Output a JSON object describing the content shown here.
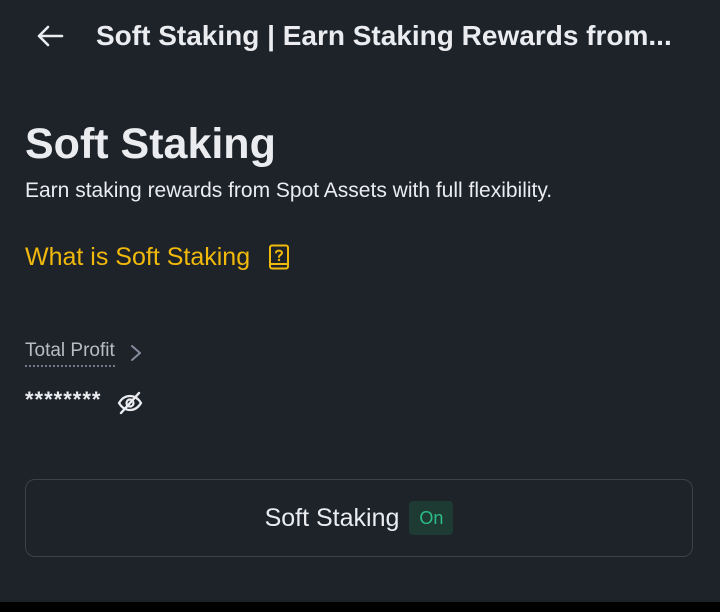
{
  "header": {
    "title": "Soft Staking | Earn Staking Rewards from...",
    "back_icon": "arrow-left-icon"
  },
  "main": {
    "title": "Soft Staking",
    "subtitle": "Earn staking rewards from Spot Assets with full flexibility.",
    "what_is_link": "What is Soft Staking",
    "what_is_icon": "book-question-icon"
  },
  "profit": {
    "label": "Total Profit",
    "value": "********",
    "chevron_icon": "chevron-right-icon",
    "visibility_icon": "eye-off-icon"
  },
  "card": {
    "label": "Soft Staking",
    "status": "On"
  },
  "colors": {
    "background": "#1e2329",
    "accent": "#f0b90b",
    "status_green": "#2ebd85",
    "status_bg": "#1d3a33"
  }
}
